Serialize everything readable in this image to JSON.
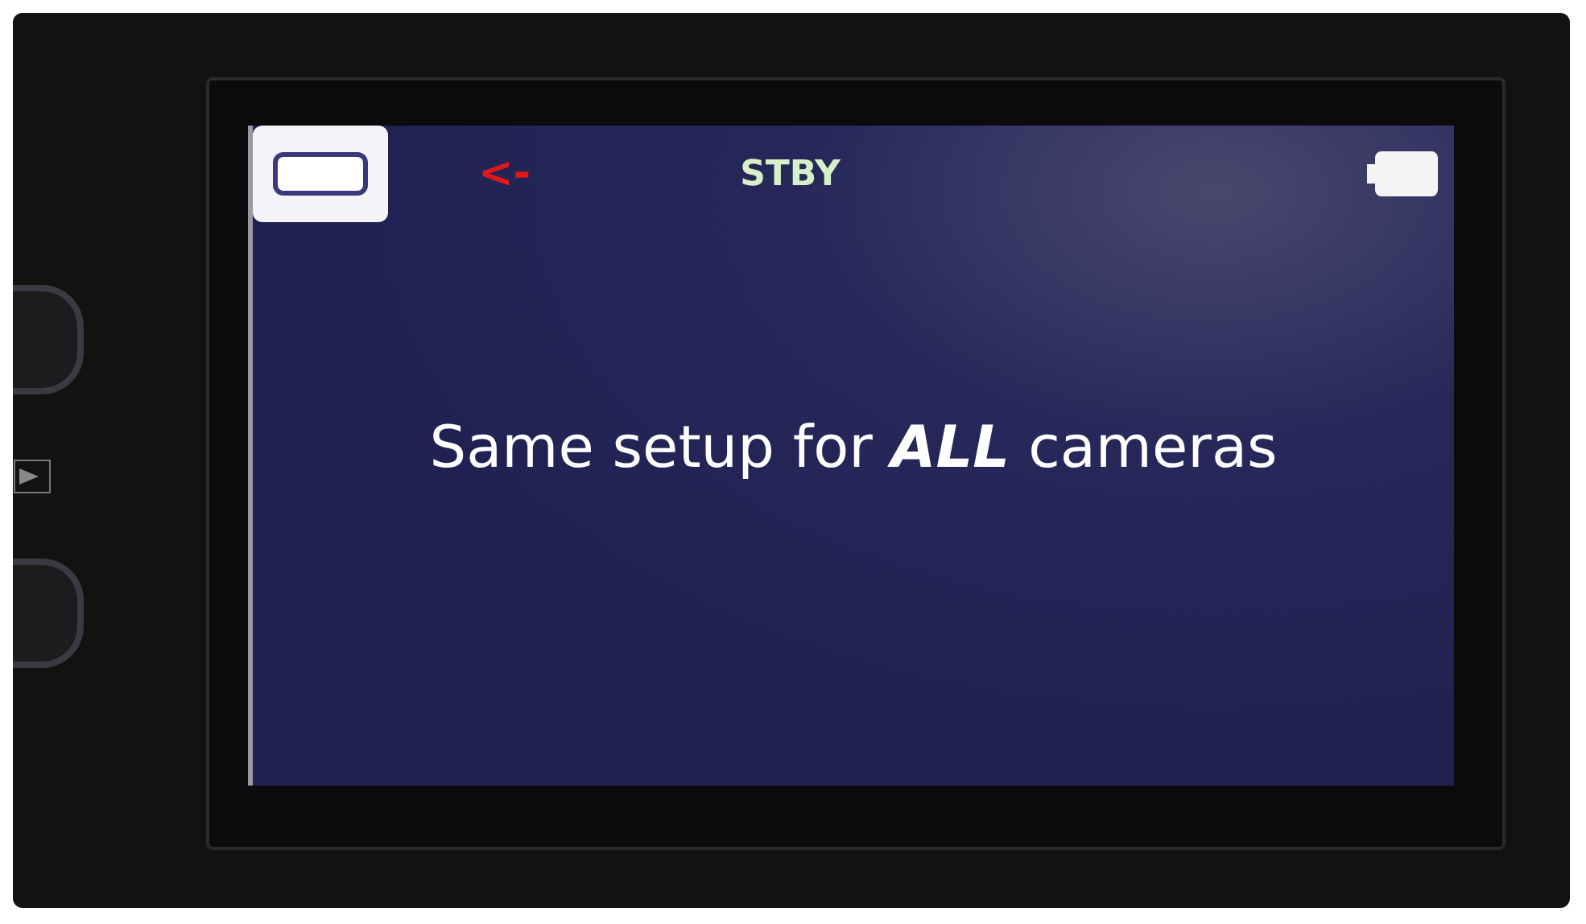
{
  "screen": {
    "hint_arrow": "<-",
    "status": "STBY"
  },
  "caption": "Same setup for **ALL** cameras"
}
